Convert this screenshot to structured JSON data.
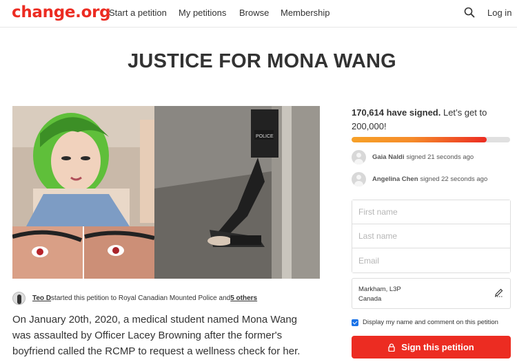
{
  "header": {
    "logo": "change.org",
    "nav": [
      "Start a petition",
      "My petitions",
      "Browse",
      "Membership"
    ],
    "login": "Log in"
  },
  "petition": {
    "title": "JUSTICE FOR MONA WANG",
    "starter_name": "Teo D",
    "starter_text": " started this petition to Royal Canadian Mounted Police and ",
    "starter_others": "5 others",
    "description": "On January 20th, 2020, a medical student named Mona Wang was assaulted by Officer Lacey Browning after the former's boyfriend called the RCMP to request a wellness check for her."
  },
  "signatures": {
    "count": "170,614 have signed.",
    "goal_text": " Let’s get to 200,000!",
    "progress": 0.85,
    "recent": [
      {
        "name": "Gaia Naldi",
        "action": "signed 21 seconds ago"
      },
      {
        "name": "Angelina Chen",
        "action": "signed 22 seconds ago"
      }
    ]
  },
  "form": {
    "first_name_placeholder": "First name",
    "last_name_placeholder": "Last name",
    "email_placeholder": "Email",
    "location_line1": "Markham, L3P",
    "location_line2": "Canada",
    "display_label": "Display my name and comment on this petition",
    "sign_button": "Sign this petition"
  },
  "colors": {
    "brand": "#ec2c22",
    "checkbox": "#1a73e8"
  }
}
